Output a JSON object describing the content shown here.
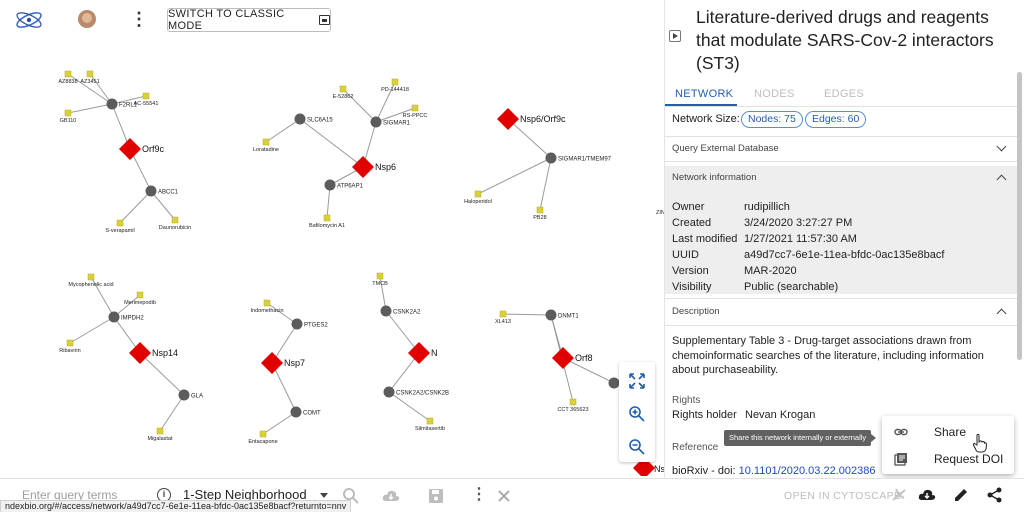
{
  "toolbar": {
    "logo_icon": "ndex-logo-icon",
    "avatar_icon": "user-avatar",
    "menu_icon": "more-vert-icon",
    "classic_mode_label": "SWITCH TO CLASSIC MODE"
  },
  "network": {
    "clusters": [
      {
        "hub": "Orf9c",
        "genes": [
          "F2RL1",
          "ABCC1"
        ],
        "drugs": [
          "AZ3451",
          "AZ8838",
          "AC-55541",
          "GB110",
          "S-verapamil",
          "Daunorubicin"
        ]
      },
      {
        "hub": "Nsp6",
        "genes": [
          "SLC6A15",
          "SIGMAR1",
          "ATP6AP1"
        ],
        "drugs": [
          "E-52862",
          "PD-144418",
          "RS-PPCC",
          "Loratadine",
          "Bafilomycin A1"
        ]
      },
      {
        "hub": "Nsp6/Orf9c",
        "genes": [
          "SIGMAR1/TMEM97"
        ],
        "drugs": [
          "Haloperidol",
          "PB28"
        ]
      },
      {
        "hub": "Nsp14",
        "genes": [
          "IMPDH2",
          "GLA"
        ],
        "drugs": [
          "Mycophenolic acid",
          "Merimepodib",
          "Ribavirin",
          "Migalastat"
        ]
      },
      {
        "hub": "Nsp7",
        "genes": [
          "PTGES2",
          "COMT"
        ],
        "drugs": [
          "Indomethacin",
          "Entacapone"
        ]
      },
      {
        "hub": "N",
        "genes": [
          "CSNK2A2",
          "CSNK2A2/CSNK2B"
        ],
        "drugs": [
          "TMCB",
          "Silmitasertib"
        ]
      },
      {
        "hub": "Orf8",
        "genes": [
          "DNMT1"
        ],
        "drugs": [
          "XL413",
          "CCT 365623"
        ]
      }
    ],
    "partial_labels": [
      "ZIN",
      "Ns"
    ],
    "zoom_controls": [
      "fit-screen-icon",
      "zoom-in-icon",
      "zoom-out-icon"
    ]
  },
  "querybar": {
    "placeholder": "Enter query terms",
    "mode": "1-Step Neighborhood",
    "icons": [
      "info-icon",
      "search-icon",
      "cloud-download-icon",
      "save-icon",
      "more-vert-icon",
      "close-icon"
    ],
    "status_url": "ndexbio.org/#/access/network/a49d7cc7-6e1e-11ea-bfdc-0ac135e8bacf?returnto=nnv"
  },
  "panel": {
    "title": "Literature-derived drugs and reagents that modulate SARS-Cov-2 interactors (ST3)",
    "tabs": [
      "NETWORK",
      "NODES",
      "EDGES"
    ],
    "active_tab": "NETWORK",
    "network_size_label": "Network Size:",
    "nodes_pill": "Nodes: 75",
    "edges_pill": "Edges: 60",
    "query_external_label": "Query External Database",
    "network_info_label": "Network information",
    "info": [
      {
        "key": "Owner",
        "value": "rudipillich"
      },
      {
        "key": "Created",
        "value": "3/24/2020 3:27:27 PM"
      },
      {
        "key": "Last modified",
        "value": "1/27/2021 11:57:30 AM"
      },
      {
        "key": "UUID",
        "value": "a49d7cc7-6e1e-11ea-bfdc-0ac135e8bacf"
      },
      {
        "key": "Version",
        "value": "MAR-2020"
      },
      {
        "key": "Visibility",
        "value": "Public (searchable)"
      }
    ],
    "description_label": "Description",
    "description": "Supplementary Table 3 - Drug-target associations drawn from chemoinformatic searches of the literature, including information about purchaseability.",
    "rights_label": "Rights",
    "rights_holder_key": "Rights holder",
    "rights_holder_value": "Nevan Krogan",
    "reference_label": "Reference",
    "reference_prefix": "bioRxiv - doi: ",
    "reference_doi": "10.1101/2020.03.22.002386"
  },
  "share_menu": {
    "tooltip": "Share this network internally or externally",
    "items": [
      {
        "label": "Share",
        "icon": "link-icon"
      },
      {
        "label": "Request DOI",
        "icon": "library-books-icon"
      }
    ]
  },
  "actionbar": {
    "open_cytoscape_label": "OPEN IN CYTOSCAPE",
    "icons": [
      "cytoscape-icon",
      "cloud-download-icon",
      "edit-icon",
      "share-icon"
    ]
  },
  "colors": {
    "accent": "#1f5fb0",
    "hub_node": "#e00000",
    "gene_node": "#5c5c5c",
    "drug_node": "#d9d03a"
  }
}
